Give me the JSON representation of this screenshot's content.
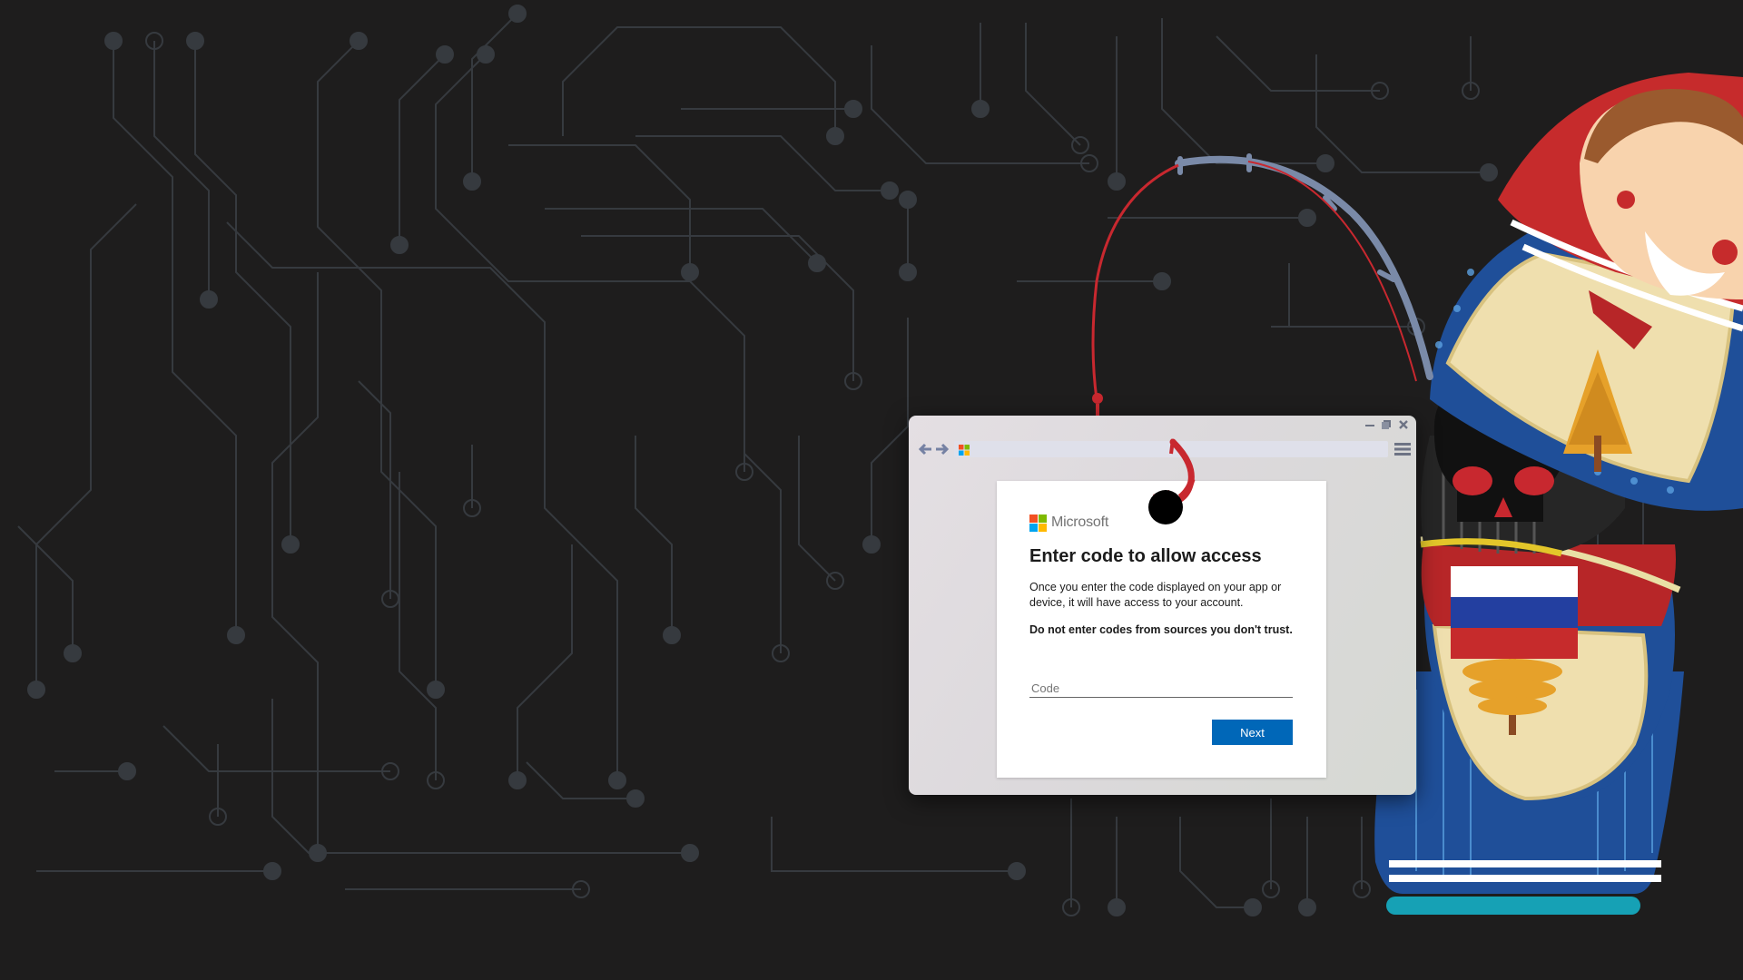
{
  "colors": {
    "background": "#1e1d1d",
    "circuit": "#3a3e43",
    "accent_blue": "#0067b8",
    "hook_red": "#c8282f",
    "doll_red": "#c62b2c",
    "doll_blue": "#1e4f9a"
  },
  "icons": {
    "back": "arrow-left-icon",
    "forward": "arrow-right-icon",
    "menu": "hamburger-menu-icon",
    "minimize": "minimize-icon",
    "maximize": "maximize-icon",
    "close": "close-icon",
    "fishing_hook": "fishing-hook-icon",
    "skull": "skull-icon"
  },
  "login": {
    "brand": "Microsoft",
    "title": "Enter code to allow access",
    "description": "Once you enter the code displayed on your app or device, it will have access to your account.",
    "warning": "Do not enter codes from sources you don't trust.",
    "code_placeholder": "Code",
    "code_value": "",
    "next_label": "Next"
  }
}
